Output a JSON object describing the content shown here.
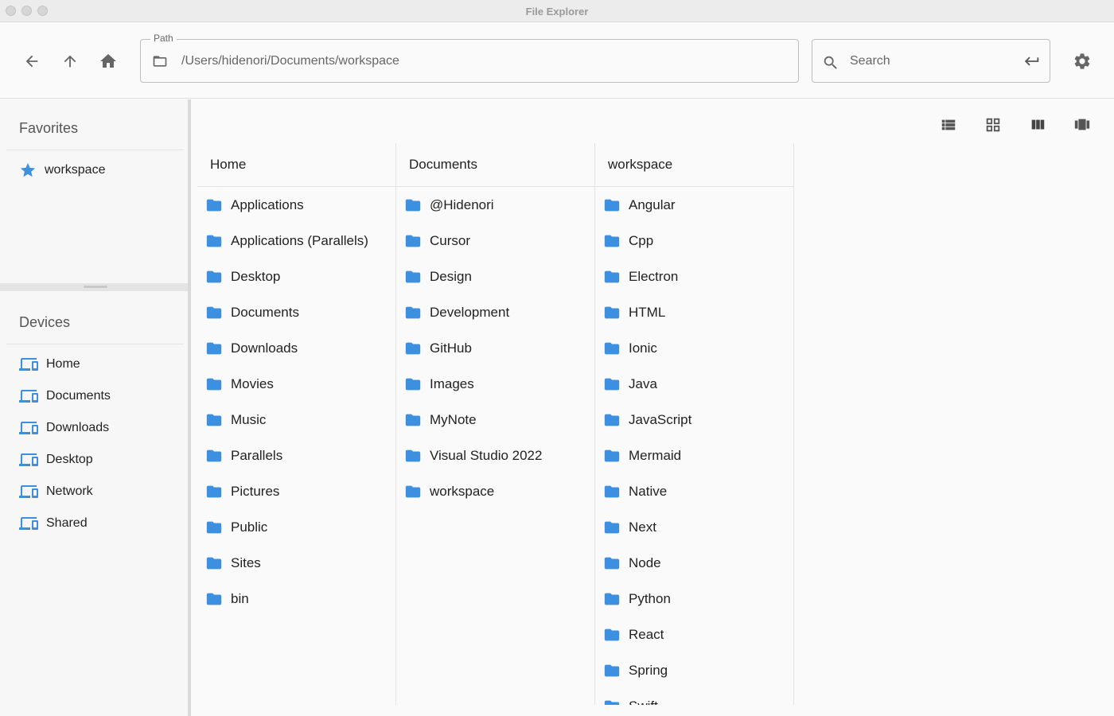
{
  "window": {
    "title": "File Explorer"
  },
  "path": {
    "legend": "Path",
    "value": "/Users/hidenori/Documents/workspace"
  },
  "search": {
    "placeholder": "Search"
  },
  "sidebar": {
    "favorites_title": "Favorites",
    "favorites": [
      {
        "label": "workspace",
        "icon": "star-icon"
      }
    ],
    "devices_title": "Devices",
    "devices": [
      {
        "label": "Home",
        "icon": "devices-icon"
      },
      {
        "label": "Documents",
        "icon": "devices-icon"
      },
      {
        "label": "Downloads",
        "icon": "devices-icon"
      },
      {
        "label": "Desktop",
        "icon": "devices-icon"
      },
      {
        "label": "Network",
        "icon": "devices-icon"
      },
      {
        "label": "Shared",
        "icon": "devices-icon"
      }
    ]
  },
  "columns": [
    {
      "header": "Home",
      "items": [
        "Applications",
        "Applications (Parallels)",
        "Desktop",
        "Documents",
        "Downloads",
        "Movies",
        "Music",
        "Parallels",
        "Pictures",
        "Public",
        "Sites",
        "bin"
      ]
    },
    {
      "header": "Documents",
      "items": [
        "@Hidenori",
        "Cursor",
        "Design",
        "Development",
        "GitHub",
        "Images",
        "MyNote",
        "Visual Studio 2022",
        "workspace"
      ]
    },
    {
      "header": "workspace",
      "items": [
        "Angular",
        "Cpp",
        "Electron",
        "HTML",
        "Ionic",
        "Java",
        "JavaScript",
        "Mermaid",
        "Native",
        "Next",
        "Node",
        "Python",
        "React",
        "Spring",
        "Swift"
      ]
    }
  ],
  "colors": {
    "accent": "#3d8fe0",
    "icon_gray": "#666666"
  }
}
